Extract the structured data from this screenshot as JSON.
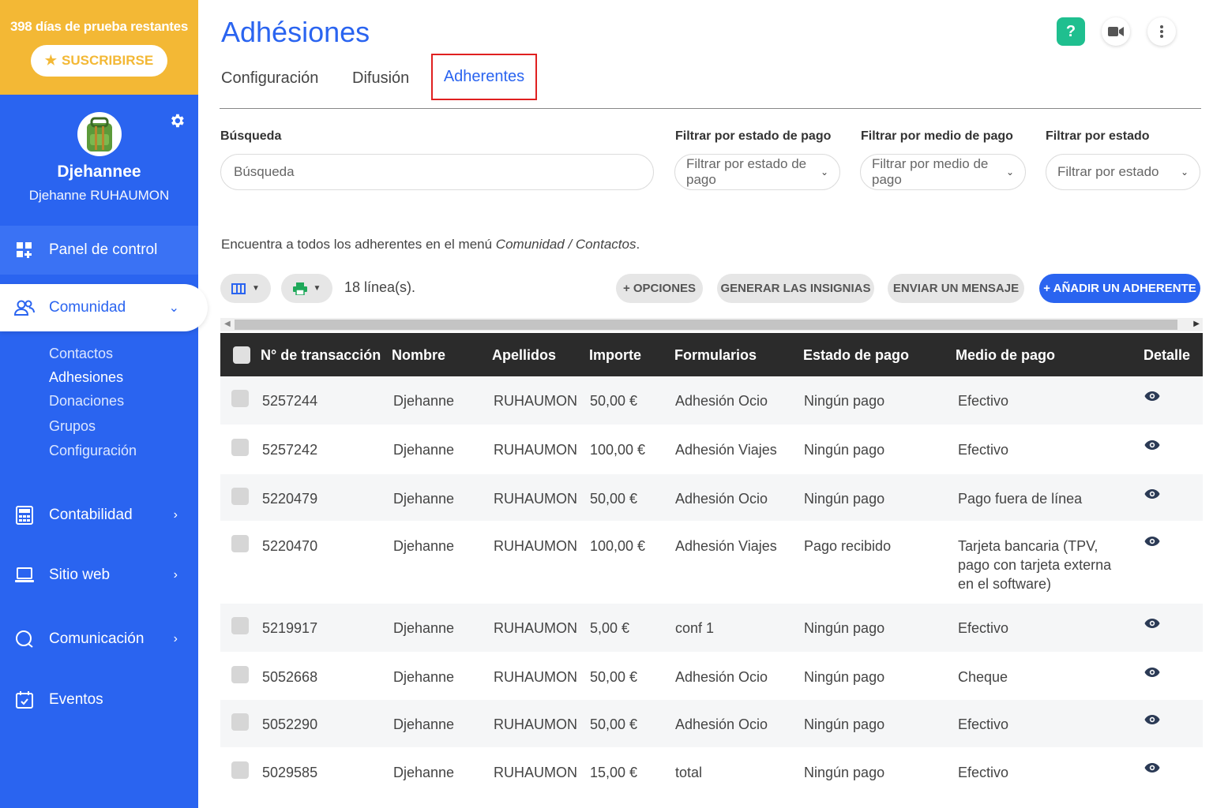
{
  "sidebar": {
    "trial_text": "398 días de prueba restantes",
    "subscribe_label": "SUSCRIBIRSE",
    "profile": {
      "name": "Djehannee",
      "full_name": "Djehanne RUHAUMON"
    },
    "nav": {
      "dashboard": "Panel de control",
      "community": "Comunidad",
      "community_sub": [
        "Contactos",
        "Adhesiones",
        "Donaciones",
        "Grupos",
        "Configuración"
      ],
      "accounting": "Contabilidad",
      "website": "Sitio web",
      "communication": "Comunicación",
      "events": "Eventos"
    }
  },
  "header": {
    "title": "Adhésiones",
    "tabs": [
      "Configuración",
      "Difusión",
      "Adherentes"
    ],
    "active_tab": "Adherentes",
    "help_label": "?"
  },
  "filters": {
    "search_label": "Búsqueda",
    "search_placeholder": "Búsqueda",
    "pay_state_label": "Filtrar por estado de pago",
    "pay_state_value": "Filtrar por estado de pago",
    "pay_method_label": "Filtrar por medio de pago",
    "pay_method_value": "Filtrar por medio de pago",
    "state_label": "Filtrar por estado",
    "state_value": "Filtrar por estado"
  },
  "info": {
    "prefix": "Encuentra a todos los adherentes en el menú ",
    "path": "Comunidad / Contactos",
    "suffix": "."
  },
  "toolbar": {
    "lines": "18 línea(s).",
    "options": "+ OPCIONES",
    "badges": "GENERAR LAS INSIGNIAS",
    "message": "ENVIAR UN MENSAJE",
    "add": "+ AÑADIR UN ADHERENTE"
  },
  "table": {
    "headers": [
      "N° de transacción",
      "Nombre",
      "Apellidos",
      "Importe",
      "Formularios",
      "Estado de pago",
      "Medio de pago",
      "Detalle"
    ],
    "rows": [
      [
        "5257244",
        "Djehanne",
        "RUHAUMON",
        "50,00 €",
        "Adhesión Ocio",
        "Ningún pago",
        "Efectivo"
      ],
      [
        "5257242",
        "Djehanne",
        "RUHAUMON",
        "100,00 €",
        "Adhesión Viajes",
        "Ningún pago",
        "Efectivo"
      ],
      [
        "5220479",
        "Djehanne",
        "RUHAUMON",
        "50,00 €",
        "Adhesión Ocio",
        "Ningún pago",
        "Pago fuera de línea"
      ],
      [
        "5220470",
        "Djehanne",
        "RUHAUMON",
        "100,00 €",
        "Adhesión Viajes",
        "Pago recibido",
        "Tarjeta bancaria (TPV, pago con tarjeta externa en el software)"
      ],
      [
        "5219917",
        "Djehanne",
        "RUHAUMON",
        "5,00 €",
        "conf 1",
        "Ningún pago",
        "Efectivo"
      ],
      [
        "5052668",
        "Djehanne",
        "RUHAUMON",
        "50,00 €",
        "Adhesión Ocio",
        "Ningún pago",
        "Cheque"
      ],
      [
        "5052290",
        "Djehanne",
        "RUHAUMON",
        "50,00 €",
        "Adhesión Ocio",
        "Ningún pago",
        "Efectivo"
      ],
      [
        "5029585",
        "Djehanne",
        "RUHAUMON",
        "15,00 €",
        "total",
        "Ningún pago",
        "Efectivo"
      ]
    ]
  },
  "colors": {
    "primary": "#2a64f0",
    "trial": "#f3b835",
    "help": "#1fbf8f",
    "header_bg": "#2b2b2b"
  }
}
